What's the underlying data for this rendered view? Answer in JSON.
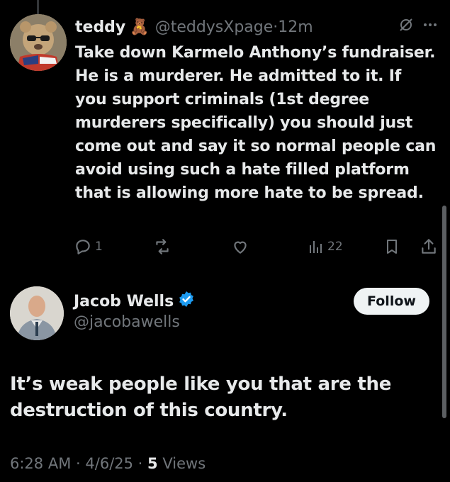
{
  "reply_to": {
    "display_name": "teddy",
    "name_emoji": "🧸",
    "handle": "@teddysXpage",
    "separator": "·",
    "time": "12m",
    "text": "Take down Karmelo Anthony’s fundraiser. He is a murderer. He admitted to it. If you support criminals (1st degree murderers specifically) you should just come out and say it so normal people can avoid using such a hate filled platform that is allowing more hate to be spread.",
    "replies": "1",
    "views": "22"
  },
  "main_tweet": {
    "display_name": "Jacob Wells",
    "handle": "@jacobawells",
    "follow_label": "Follow",
    "text": "It’s weak people like you that are the destruction of this country.",
    "time": "6:28 AM",
    "date": "4/6/25",
    "views_count": "5",
    "views_label": "Views",
    "separator": "·"
  },
  "colors": {
    "background": "#000000",
    "text": "#e7e9ea",
    "muted": "#71767b",
    "verified": "#1d9bf0",
    "follow_bg": "#eff3f4"
  },
  "icons": [
    "reply-icon",
    "retweet-icon",
    "like-icon",
    "views-icon",
    "bookmark-icon",
    "share-icon",
    "grok-icon",
    "more-icon",
    "verified-badge-icon"
  ]
}
